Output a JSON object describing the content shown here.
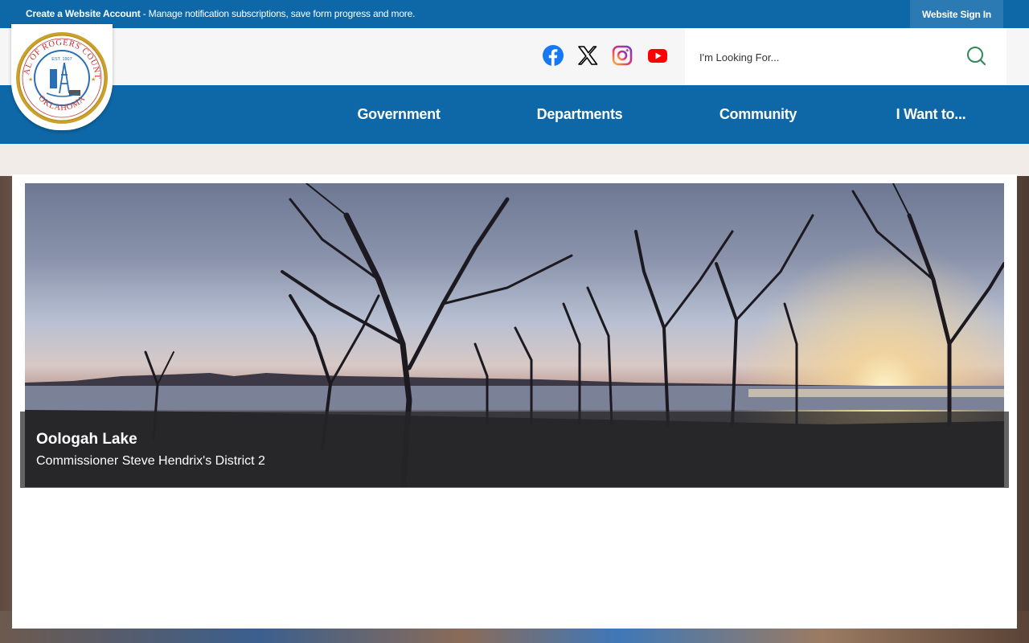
{
  "topbar": {
    "account_link": "Create a Website Account",
    "account_text": " - Manage notification subscriptions, save form progress and more.",
    "signin": "Website Sign In"
  },
  "header": {
    "social": [
      {
        "name": "facebook-icon",
        "color": "#1877f2"
      },
      {
        "name": "x-icon",
        "color": "#000000"
      },
      {
        "name": "instagram-icon",
        "color": "#d6249f"
      },
      {
        "name": "youtube-icon",
        "color": "#ff0000"
      }
    ],
    "search": {
      "placeholder": "I'm Looking For..."
    }
  },
  "seal": {
    "text_top": "SEAL OF ROGERS COUNTY",
    "text_bottom": "OKLAHOMA",
    "est": "EST. 1907"
  },
  "nav": {
    "items": [
      "Government",
      "Departments",
      "Community",
      "I Want to..."
    ]
  },
  "hero": {
    "title": "Oologah Lake",
    "subtitle": "Commissioner Steve Hendrix's District 2"
  },
  "colors": {
    "brand": "#0e68a8",
    "signin_bg": "#2b7ab4"
  }
}
